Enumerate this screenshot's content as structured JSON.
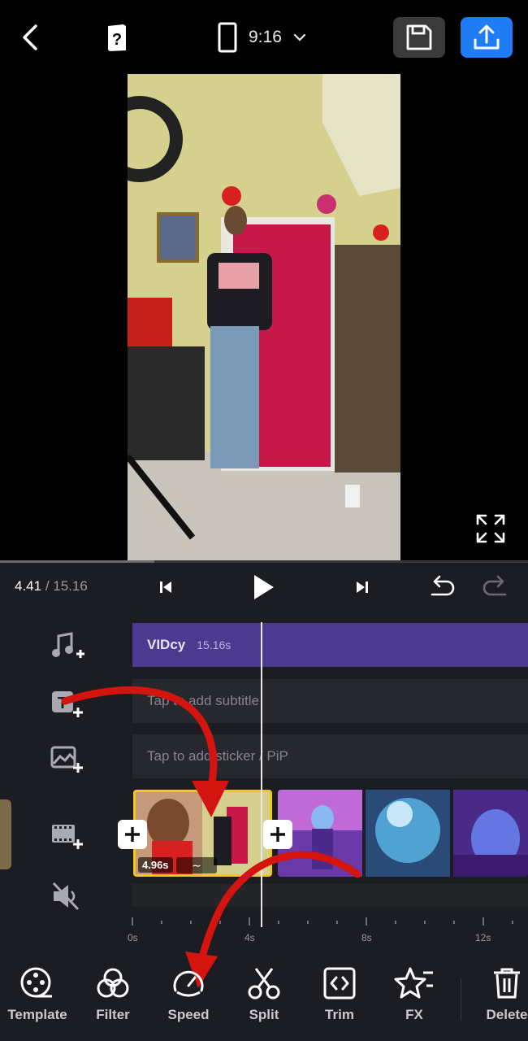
{
  "header": {
    "aspect_ratio": "9:16",
    "icons": [
      "back-arrow-icon",
      "help-book-icon",
      "phone-portrait-icon",
      "chevron-down-icon",
      "save-floppy-icon",
      "upload-export-icon"
    ],
    "export_color": "#1f7cf5"
  },
  "playback": {
    "current_time": "4.41",
    "separator": " / ",
    "total_time": "15.16"
  },
  "tracks": {
    "music": {
      "name": "VIDcy",
      "duration": "15.16s",
      "color": "#4b3a8f"
    },
    "subtitle": {
      "placeholder": "Tap to add subtitle"
    },
    "sticker": {
      "placeholder": "Tap to add sticker / PiP"
    },
    "clip1": {
      "duration": "4.96s",
      "border_color": "#f2c811"
    }
  },
  "ruler": {
    "labels": [
      "0s",
      "4s",
      "8s",
      "12s"
    ]
  },
  "toolbar": {
    "items": [
      {
        "label": "Template",
        "icon": "film-reel-icon"
      },
      {
        "label": "Filter",
        "icon": "filter-circles-icon"
      },
      {
        "label": "Speed",
        "icon": "speedometer-icon"
      },
      {
        "label": "Split",
        "icon": "scissors-icon"
      },
      {
        "label": "Trim",
        "icon": "trim-brackets-icon"
      },
      {
        "label": "FX",
        "icon": "star-effects-icon"
      },
      {
        "label": "Delete",
        "icon": "trash-icon"
      }
    ]
  }
}
